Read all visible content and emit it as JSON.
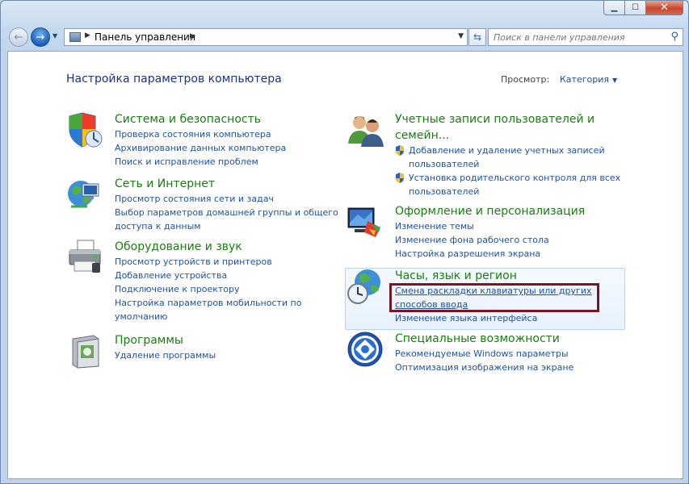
{
  "address": {
    "path": "Панель управления"
  },
  "search": {
    "placeholder": "Поиск в панели управления"
  },
  "content": {
    "heading": "Настройка параметров компьютера",
    "view_by_label": "Просмотр:",
    "view_by_value": "Категория"
  },
  "left_categories": [
    {
      "title": "Система и безопасность",
      "links": [
        "Проверка состояния компьютера",
        "Архивирование данных компьютера",
        "Поиск и исправление проблем"
      ]
    },
    {
      "title": "Сеть и Интернет",
      "links": [
        "Просмотр состояния сети и задач",
        "Выбор параметров домашней группы и общего",
        "доступа к данным"
      ]
    },
    {
      "title": "Оборудование и звук",
      "links": [
        "Просмотр устройств и принтеров",
        "Добавление устройства",
        "Подключение к проектору",
        "Настройка параметров мобильности по",
        "умолчанию"
      ]
    },
    {
      "title": "Программы",
      "links": [
        "Удаление программы"
      ]
    }
  ],
  "right_categories": [
    {
      "title_line1": "Учетные записи пользователей и",
      "title_line2": "семейн...",
      "links": [
        "Добавление и удаление учетных записей",
        "пользователей",
        "Установка родительского контроля для всех",
        "пользователей"
      ]
    },
    {
      "title": "Оформление и персонализация",
      "links": [
        "Изменение темы",
        "Изменение фона рабочего стола",
        "Настройка разрешения экрана"
      ]
    },
    {
      "title": "Часы, язык и регион",
      "links": [
        "Смена раскладки клавиатуры или других",
        "способов ввода",
        "Изменение языка интерфейса"
      ]
    },
    {
      "title": "Специальные возможности",
      "links": [
        "Рекомендуемые Windows параметры",
        "Оптимизация изображения на экране"
      ]
    }
  ],
  "colors": {
    "category_title": "#187f0e",
    "link": "#1e52a8",
    "heading": "#1e3287",
    "highlight_border": "#7a1522"
  }
}
